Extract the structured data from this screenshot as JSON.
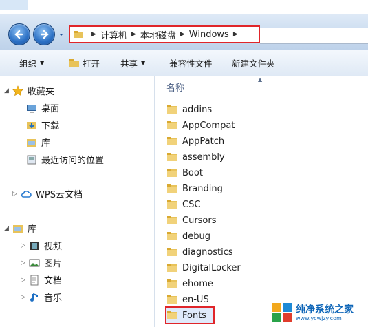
{
  "address": {
    "segments": [
      "计算机",
      "本地磁盘",
      "Windows"
    ]
  },
  "toolbar": {
    "organize": "组织",
    "open": "打开",
    "share": "共享",
    "compat": "兼容性文件",
    "new_folder": "新建文件夹"
  },
  "nav": {
    "favorites": "收藏夹",
    "desktop": "桌面",
    "downloads": "下载",
    "library": "库",
    "recent": "最近访问的位置",
    "wps": "WPS云文档",
    "libraries": "库",
    "videos": "视频",
    "pictures": "图片",
    "documents": "文档",
    "music": "音乐"
  },
  "list": {
    "column_name": "名称",
    "items": [
      "addins",
      "AppCompat",
      "AppPatch",
      "assembly",
      "Boot",
      "Branding",
      "CSC",
      "Cursors",
      "debug",
      "diagnostics",
      "DigitalLocker",
      "ehome",
      "en-US",
      "Fonts"
    ],
    "selected": "Fonts"
  },
  "watermark": {
    "title": "纯净系统之家",
    "url": "www.ycwjzy.com"
  },
  "colors": {
    "highlight_red": "#e0252a",
    "accent_blue": "#2a6fc4"
  }
}
